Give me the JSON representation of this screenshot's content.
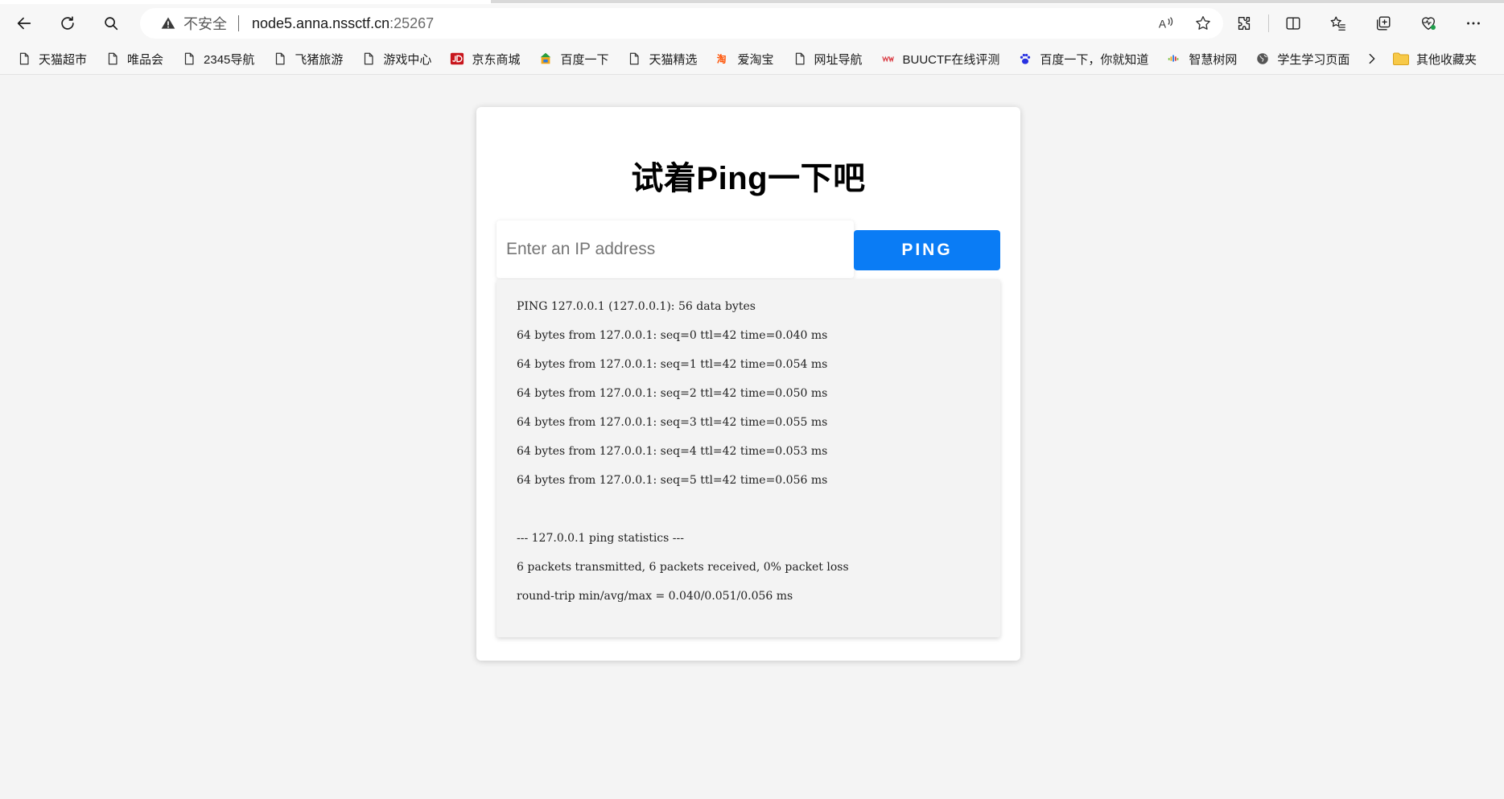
{
  "browser": {
    "insecure_label": "不安全",
    "url_host": "node5.anna.nssctf.cn",
    "url_port": ":25267"
  },
  "bookmarks": [
    {
      "label": "天猫超市",
      "icon": "page-icon"
    },
    {
      "label": "唯品会",
      "icon": "page-icon"
    },
    {
      "label": "2345导航",
      "icon": "page-icon"
    },
    {
      "label": "飞猪旅游",
      "icon": "page-icon"
    },
    {
      "label": "游戏中心",
      "icon": "page-icon"
    },
    {
      "label": "京东商城",
      "icon": "jd-icon"
    },
    {
      "label": "百度一下",
      "icon": "baidu-2345-icon"
    },
    {
      "label": "天猫精选",
      "icon": "page-icon"
    },
    {
      "label": "爱淘宝",
      "icon": "taobao-icon"
    },
    {
      "label": "网址导航",
      "icon": "page-icon"
    },
    {
      "label": "BUUCTF在线评测",
      "icon": "buuctf-icon"
    },
    {
      "label": "百度一下，你就知道",
      "icon": "baidu-paw-icon"
    },
    {
      "label": "智慧树网",
      "icon": "zhihuishu-icon"
    },
    {
      "label": "学生学习页面",
      "icon": "globe-icon"
    }
  ],
  "other_bookmarks": "其他收藏夹",
  "page": {
    "title": "试着Ping一下吧",
    "input_placeholder": "Enter an IP address",
    "button_label": "PING",
    "output_lines": [
      "PING 127.0.0.1 (127.0.0.1): 56 data bytes",
      "64 bytes from 127.0.0.1: seq=0 ttl=42 time=0.040 ms",
      "64 bytes from 127.0.0.1: seq=1 ttl=42 time=0.054 ms",
      "64 bytes from 127.0.0.1: seq=2 ttl=42 time=0.050 ms",
      "64 bytes from 127.0.0.1: seq=3 ttl=42 time=0.055 ms",
      "64 bytes from 127.0.0.1: seq=4 ttl=42 time=0.053 ms",
      "64 bytes from 127.0.0.1: seq=5 ttl=42 time=0.056 ms",
      "",
      "--- 127.0.0.1 ping statistics ---",
      "6 packets transmitted, 6 packets received, 0% packet loss",
      "round-trip min/avg/max = 0.040/0.051/0.056 ms"
    ]
  },
  "colors": {
    "accent": "#0a7cf5",
    "page_background": "#f4f4f4",
    "output_background": "#f3f3f3"
  }
}
